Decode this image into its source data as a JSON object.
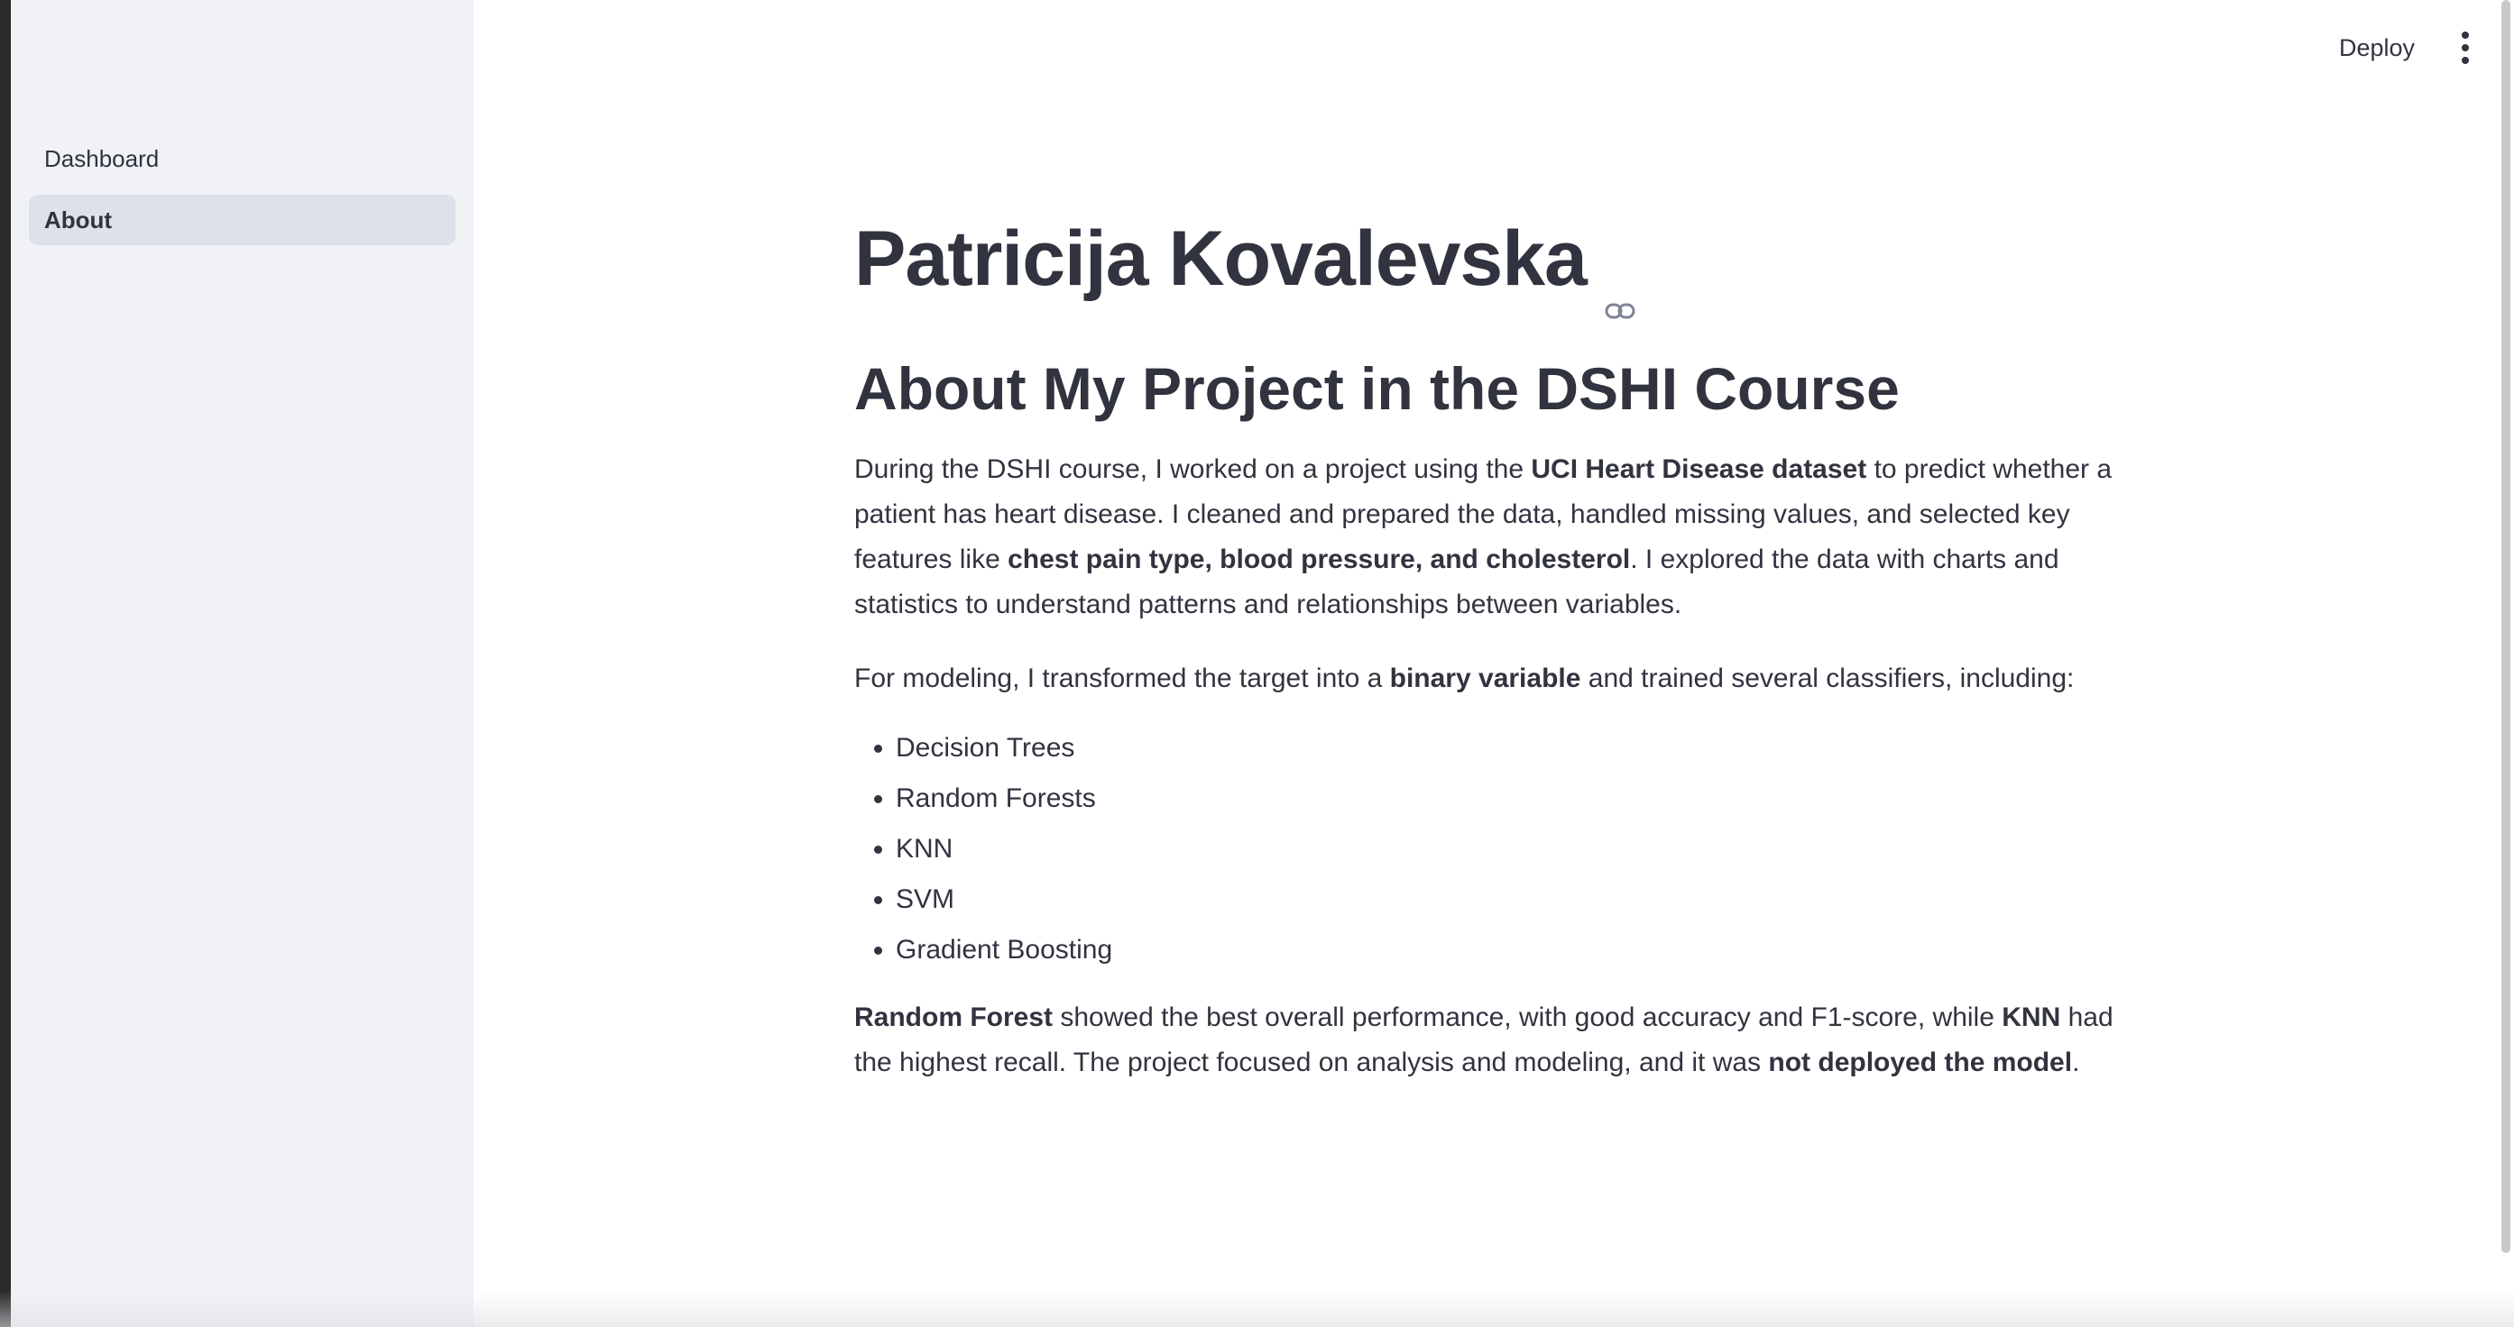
{
  "sidebar": {
    "items": [
      {
        "label": "Dashboard",
        "active": false
      },
      {
        "label": "About",
        "active": true
      }
    ]
  },
  "toolbar": {
    "deploy_label": "Deploy",
    "menu_icon": "more-vertical-icon"
  },
  "main": {
    "title": "Patricija Kovalevska",
    "title_link_icon": "link-icon",
    "heading": "About My Project in the DSHI Course",
    "p1": {
      "a": "During the DSHI course, I worked on a project using the ",
      "b1": "UCI Heart Disease dataset",
      "c": " to predict whether a patient has heart disease. I cleaned and prepared the data, handled missing values, and selected key features like ",
      "b2": "chest pain type, blood pressure, and cholesterol",
      "d": ". I explored the data with charts and statistics to understand patterns and relationships between variables."
    },
    "p2": {
      "a": "For modeling, I transformed the target into a ",
      "b1": "binary variable",
      "c": " and trained several classifiers, including:"
    },
    "list": [
      "Decision Trees",
      "Random Forests",
      "KNN",
      "SVM",
      "Gradient Boosting"
    ],
    "p3": {
      "b1": "Random Forest",
      "a": " showed the best overall performance, with good accuracy and F1-score, while ",
      "b2": "KNN",
      "c": " had the highest recall. The project focused on analysis and modeling, and it was ",
      "b3": "not deployed the model",
      "d": "."
    }
  },
  "colors": {
    "sidebar_bg": "#f0f2f6",
    "active_item_bg": "#dde1ea",
    "text": "#31333f"
  }
}
